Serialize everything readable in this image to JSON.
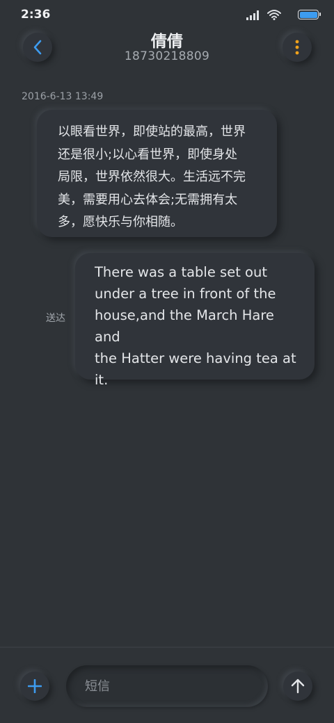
{
  "status_bar": {
    "time": "2:36",
    "icons": [
      "signal-icon",
      "wifi-icon",
      "battery-icon"
    ],
    "battery_color": "#3d9cf0"
  },
  "header": {
    "contact_name": "倩倩",
    "contact_number": "18730218809",
    "back_icon": "chevron-left-icon",
    "more_icon": "more-vertical-icon",
    "accent_blue": "#3d9cf0",
    "accent_orange": "#f0a21c"
  },
  "conversation": {
    "timestamp": "2016-6-13 13:49",
    "messages": [
      {
        "direction": "received",
        "lines": [
          "以眼看世界，即使站的最高，世界",
          "还是很小;以心看世界，即使身处",
          "局限，世界依然很大。生活远不完",
          "美，需要用心去体会;无需拥有太",
          "多，愿快乐与你相随。"
        ]
      },
      {
        "direction": "sent",
        "status": "送达",
        "lines": [
          "There was a table set out",
          "under a tree in front of the",
          "house,and the March Hare and",
          "the Hatter were having tea at",
          "it."
        ]
      }
    ]
  },
  "composer": {
    "placeholder": "短信",
    "value": "",
    "add_icon": "plus-icon",
    "send_icon": "arrow-up-icon"
  }
}
